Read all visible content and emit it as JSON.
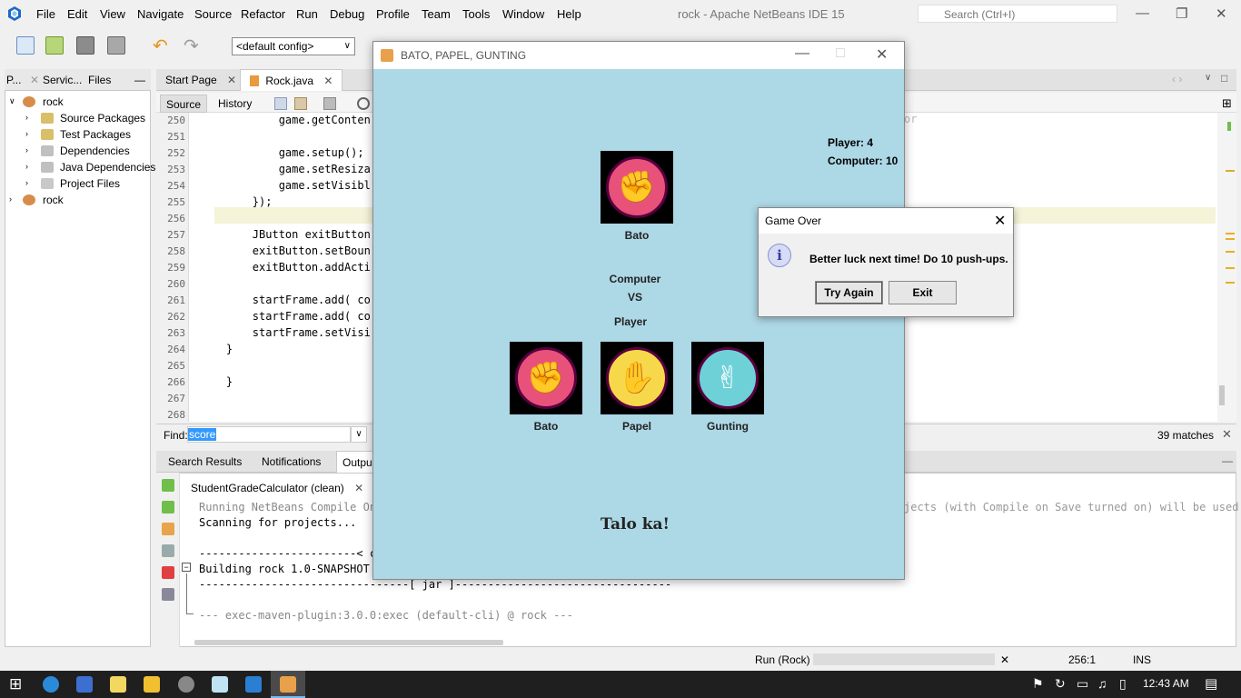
{
  "menubar": {
    "items": [
      "File",
      "Edit",
      "View",
      "Navigate",
      "Source",
      "Refactor",
      "Run",
      "Debug",
      "Profile",
      "Team",
      "Tools",
      "Window",
      "Help"
    ],
    "title": "rock - Apache NetBeans IDE 15",
    "search_placeholder": "Search (Ctrl+I)"
  },
  "toolbar": {
    "config": "<default config>"
  },
  "projects": {
    "tabs": [
      "P...",
      "Servic...",
      "Files"
    ],
    "tree": [
      {
        "label": "rock",
        "level": 0
      },
      {
        "label": "Source Packages",
        "level": 1
      },
      {
        "label": "Test Packages",
        "level": 1
      },
      {
        "label": "Dependencies",
        "level": 1
      },
      {
        "label": "Java Dependencies",
        "level": 1
      },
      {
        "label": "Project Files",
        "level": 1
      },
      {
        "label": "rock",
        "level": 0
      }
    ]
  },
  "editor": {
    "tabs": [
      "Start Page",
      "Rock.java"
    ],
    "subtabs": [
      "Source",
      "History"
    ],
    "lines": [
      {
        "n": "250",
        "code": "            game.getConten"
      },
      {
        "n": "251",
        "code": ""
      },
      {
        "n": "252",
        "code": "            game.setup();"
      },
      {
        "n": "253",
        "code": "            game.setResiza"
      },
      {
        "n": "254",
        "code": "            game.setVisibl"
      },
      {
        "n": "255",
        "code": "        });"
      },
      {
        "n": "256",
        "code": ""
      },
      {
        "n": "257",
        "code": "        JButton exitButton"
      },
      {
        "n": "258",
        "code": "        exitButton.setBoun"
      },
      {
        "n": "259",
        "code": "        exitButton.addActi"
      },
      {
        "n": "260",
        "code": ""
      },
      {
        "n": "261",
        "code": "        startFrame.add( co"
      },
      {
        "n": "262",
        "code": "        startFrame.add( co"
      },
      {
        "n": "263",
        "code": "        startFrame.setVisi"
      },
      {
        "n": "264",
        "code": "    }"
      },
      {
        "n": "265",
        "code": ""
      },
      {
        "n": "266",
        "code": "    }"
      },
      {
        "n": "267",
        "code": ""
      },
      {
        "n": "268",
        "code": ""
      }
    ],
    "overflow_fragment": "or"
  },
  "find": {
    "label": "Find:",
    "value": "score",
    "matches": "39 matches"
  },
  "output": {
    "tabs": [
      "Search Results",
      "Notifications",
      "Outpu"
    ],
    "subtab": "StudentGradeCalculator (clean)",
    "lines": [
      "Running NetBeans Compile On",
      "Scanning for projects...",
      "",
      "------------------------< c",
      "Building rock 1.0-SNAPSHOT",
      "--------------------------------[ jar ]---------------------------------",
      "",
      "--- exec-maven-plugin:3.0.0:exec (default-cli) @ rock ---"
    ],
    "overflow_fragment": "jects (with Compile on Save turned on) will be used"
  },
  "statusbar": {
    "run": "Run (Rock)",
    "position": "256:1",
    "mode": "INS"
  },
  "taskbar": {
    "time": "12:43 AM"
  },
  "game": {
    "title": "BATO, PAPEL, GUNTING",
    "score_player": "Player: 4",
    "score_computer": "Computer: 10",
    "computer_choice_label": "Bato",
    "computer_label": "Computer",
    "vs_label": "VS",
    "player_label": "Player",
    "choices": [
      "Bato",
      "Papel",
      "Gunting"
    ],
    "result": "Talo ka!",
    "colors": {
      "bato": "#e8527a",
      "papel": "#f7d84a",
      "gunting": "#6fd1d8",
      "background": "#add8e6"
    }
  },
  "dialog": {
    "title": "Game Over",
    "message": "Better luck next time! Do 10 push-ups.",
    "try_again": "Try Again",
    "exit": "Exit"
  }
}
